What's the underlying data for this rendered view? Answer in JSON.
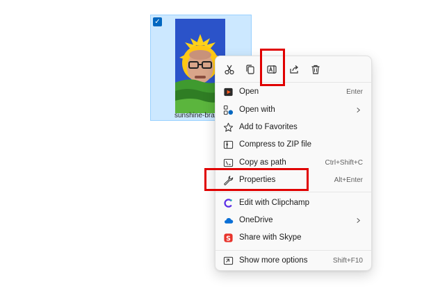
{
  "file": {
    "label": "sunshine-bran",
    "checkbox": "check-icon"
  },
  "quick_actions": [
    {
      "name": "cut-icon"
    },
    {
      "name": "copy-icon"
    },
    {
      "name": "rename-icon"
    },
    {
      "name": "share-icon"
    },
    {
      "name": "delete-icon"
    }
  ],
  "menu": {
    "open": {
      "label": "Open",
      "shortcut": "Enter",
      "icon": "media-player-icon"
    },
    "open_with": {
      "label": "Open with",
      "icon": "open-with-icon"
    },
    "favorites": {
      "label": "Add to Favorites",
      "icon": "star-icon"
    },
    "compress": {
      "label": "Compress to ZIP file",
      "icon": "zip-icon"
    },
    "copy_path": {
      "label": "Copy as path",
      "shortcut": "Ctrl+Shift+C",
      "icon": "path-icon"
    },
    "properties": {
      "label": "Properties",
      "shortcut": "Alt+Enter",
      "icon": "wrench-icon"
    },
    "clipchamp": {
      "label": "Edit with Clipchamp",
      "icon": "clipchamp-icon"
    },
    "onedrive": {
      "label": "OneDrive",
      "icon": "cloud-icon"
    },
    "skype": {
      "label": "Share with Skype",
      "icon": "skype-icon"
    },
    "more": {
      "label": "Show more options",
      "shortcut": "Shift+F10",
      "icon": "more-options-icon"
    }
  },
  "colors": {
    "selection": "#cce8ff",
    "highlight": "#e00000",
    "accent": "#0067c0"
  }
}
